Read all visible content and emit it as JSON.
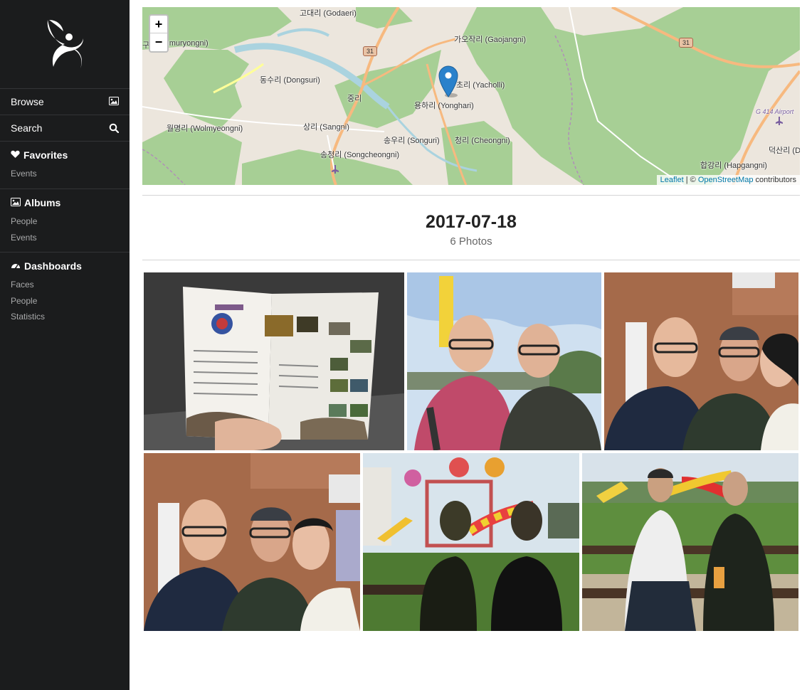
{
  "sidebar": {
    "browse_label": "Browse",
    "search_label": "Search",
    "favorites": {
      "header": "Favorites",
      "items": [
        "Events"
      ]
    },
    "albums": {
      "header": "Albums",
      "items": [
        "People",
        "Events"
      ]
    },
    "dashboards": {
      "header": "Dashboards",
      "items": [
        "Faces",
        "People",
        "Statistics"
      ]
    }
  },
  "map": {
    "zoom_in": "+",
    "zoom_out": "−",
    "labels": [
      "고대리 (Godaeri)",
      "가오작리 (Gaojangni)",
      "구.",
      "Sangmuryongni)",
      "동수리 (Dongsuri)",
      "중리",
      "초리 (Yacholli)",
      "용하리 (Yonghari)",
      "월명리 (Wolmyeongni)",
      "상리 (Sangni)",
      "송우리 (Songuri)",
      "청리 (Cheongni)",
      "송청리 (Songcheongni)",
      "합강리 (Hapgangni)",
      "덕산리 (D",
      "G 414 Airport"
    ],
    "route_numbers": [
      "31",
      "31"
    ],
    "attribution": {
      "leaflet": "Leaflet",
      "sep": " | © ",
      "osm": "OpenStreetMap",
      "suffix": " contributors"
    },
    "colors": {
      "forest": "#a7cf95",
      "land": "#ece6dd",
      "water": "#aad3df",
      "road": "#f7b97f",
      "minor_road": "#ffffff",
      "marker": "#2a81cb"
    }
  },
  "header": {
    "date": "2017-07-18",
    "count": "6 Photos"
  },
  "photos": [
    {
      "name": "photo-brochure"
    },
    {
      "name": "photo-two-men-sign"
    },
    {
      "name": "photo-three-selfie-1"
    },
    {
      "name": "photo-three-selfie-2"
    },
    {
      "name": "photo-playground-sitting"
    },
    {
      "name": "photo-bench-couple"
    }
  ]
}
